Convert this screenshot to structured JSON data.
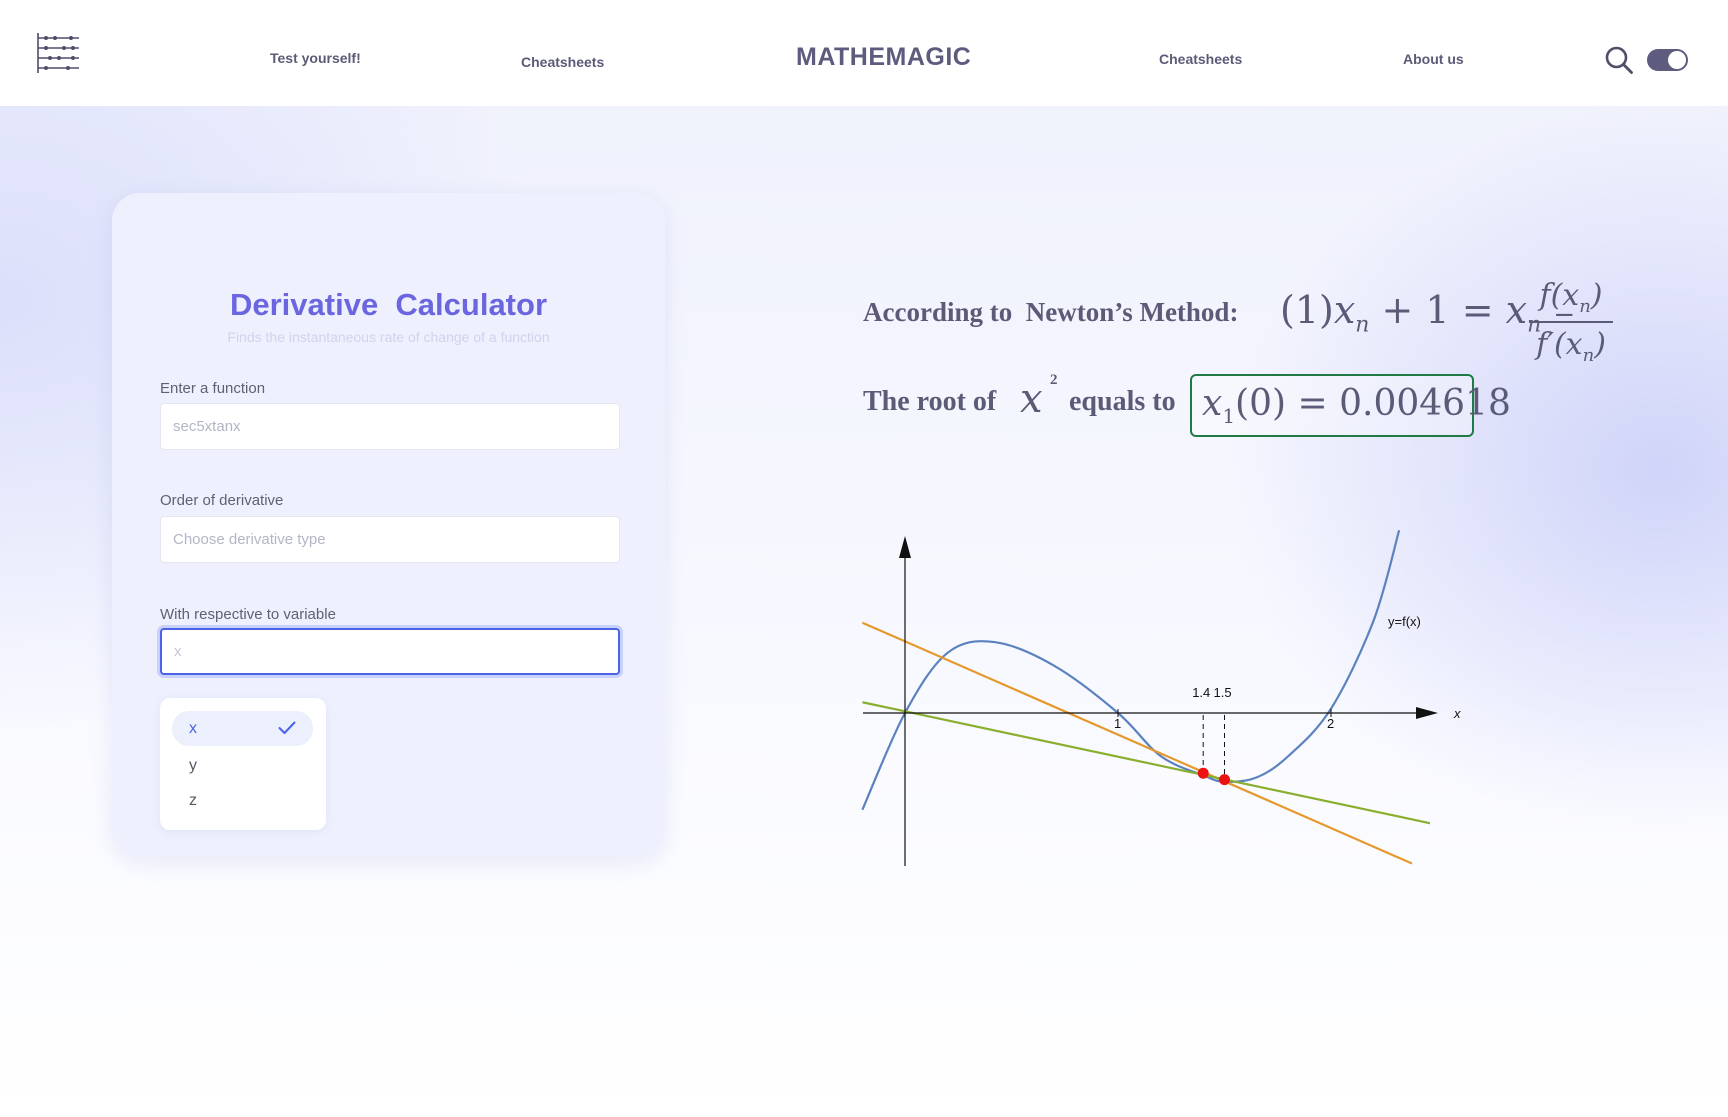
{
  "header": {
    "brand": "MATHEMAGIC",
    "nav": [
      {
        "label": "Test yourself!"
      },
      {
        "label": "Cheatsheets"
      },
      {
        "label": "Cheatsheets"
      },
      {
        "label": "About us"
      }
    ],
    "logo_icon": "abacus-icon",
    "search_icon": "search-icon",
    "theme_toggle": "on",
    "theme_color": "#5d5c7e"
  },
  "calculator": {
    "title": "Derivative  Calculator",
    "subtitle": "Finds the instantaneous rate of change of a function",
    "function_label": "Enter a function",
    "function_placeholder": "sec5xtanx",
    "order_label": "Order of derivative",
    "order_placeholder": "Choose derivative type",
    "variable_label": "With respective to variable",
    "variable_placeholder": "x",
    "variable_options": [
      "x",
      "y",
      "z"
    ],
    "variable_selected": "x",
    "accent_color": "#6b66e0"
  },
  "newton": {
    "label": "According to  Newton’s Method:",
    "formula_lhs_prefix": "(1)",
    "formula_num": "f(x",
    "formula_den": "f′(x",
    "root_label": "The root of",
    "root_var": "x",
    "root_exp": "2",
    "root_equals": "equals to",
    "result_value": "0.004618",
    "result_box_color": "#1f7a45"
  },
  "chart_data": {
    "type": "line",
    "title": "",
    "xlabel": "x",
    "ylabel": "",
    "curve_label": "y=f(x)",
    "x_ticks": [
      "1",
      "2"
    ],
    "x_annotations": [
      "1.4",
      "1.5"
    ],
    "xlim": [
      -0.2,
      2.5
    ],
    "ylim": [
      -0.7,
      0.8
    ],
    "series": [
      {
        "name": "y=f(x)",
        "color": "#5b82be",
        "x": [
          -0.2,
          0.0,
          0.2,
          0.42,
          0.7,
          1.0,
          1.2,
          1.4,
          1.5,
          1.65,
          1.8,
          2.0,
          2.2,
          2.32
        ],
        "y": [
          -0.45,
          0.0,
          0.28,
          0.33,
          0.22,
          0.0,
          -0.2,
          -0.29,
          -0.32,
          -0.3,
          -0.2,
          0.02,
          0.43,
          0.85
        ]
      },
      {
        "color": "#e5982b",
        "x": [
          -0.2,
          2.38
        ],
        "y": [
          0.42,
          -0.7
        ]
      },
      {
        "color": "#8aaf2e",
        "x": [
          -0.2,
          2.5
        ],
        "y": [
          0.05,
          -0.52
        ]
      }
    ],
    "points": [
      {
        "x": 1.4,
        "y": -0.28,
        "color": "#ee1111"
      },
      {
        "x": 1.5,
        "y": -0.31,
        "color": "#ee1111"
      }
    ],
    "grid": false
  }
}
